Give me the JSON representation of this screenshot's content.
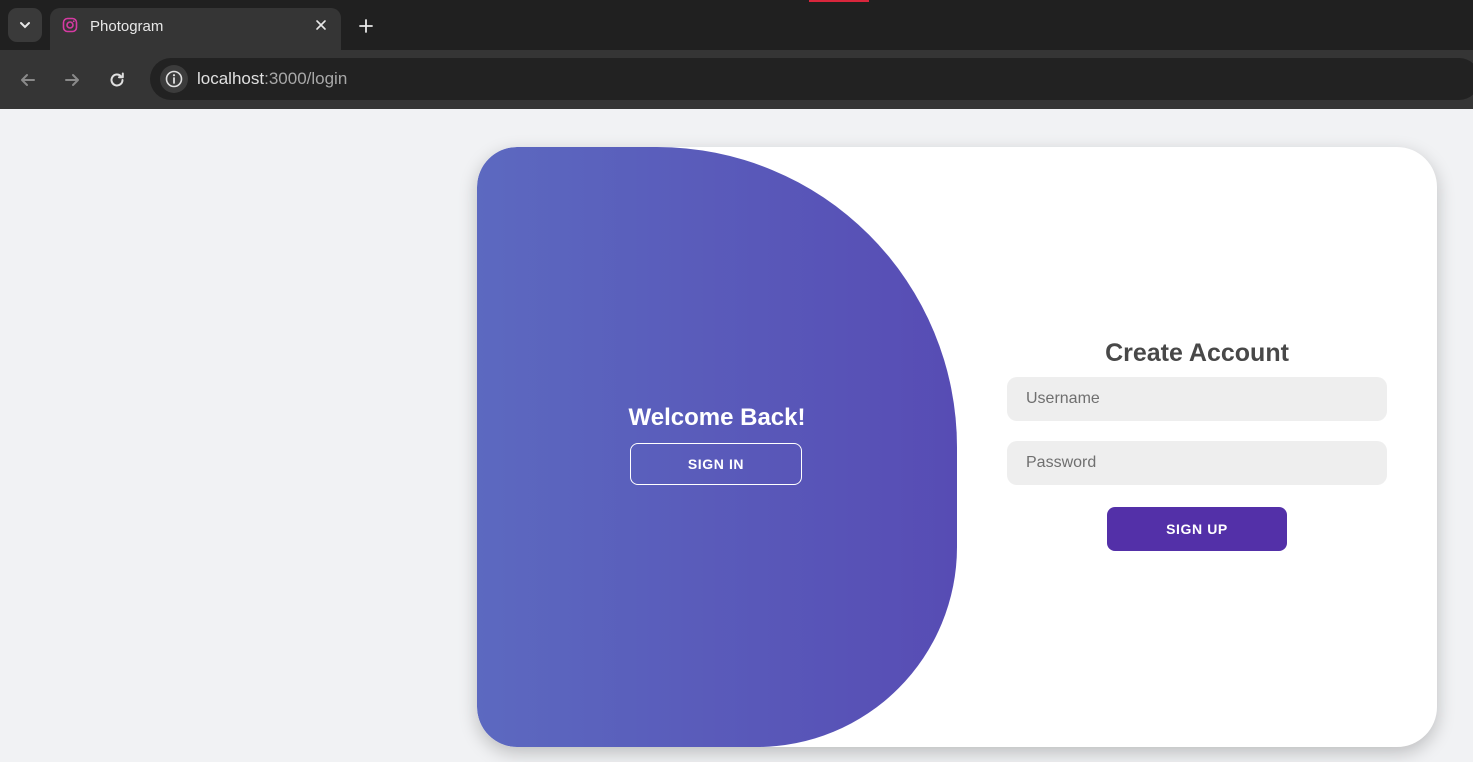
{
  "browser": {
    "tab": {
      "title": "Photogram",
      "favicon": "instagram-icon"
    },
    "address": {
      "host": "localhost",
      "rest": ":3000/login"
    }
  },
  "overlay": {
    "heading": "Welcome Back!",
    "signin_label": "SIGN IN"
  },
  "form": {
    "title": "Create Account",
    "username_placeholder": "Username",
    "password_placeholder": "Password",
    "signup_label": "SIGN UP"
  },
  "colors": {
    "gradient_start": "#5c69c0",
    "gradient_end": "#574cb4",
    "signup_button": "#5330a8"
  }
}
